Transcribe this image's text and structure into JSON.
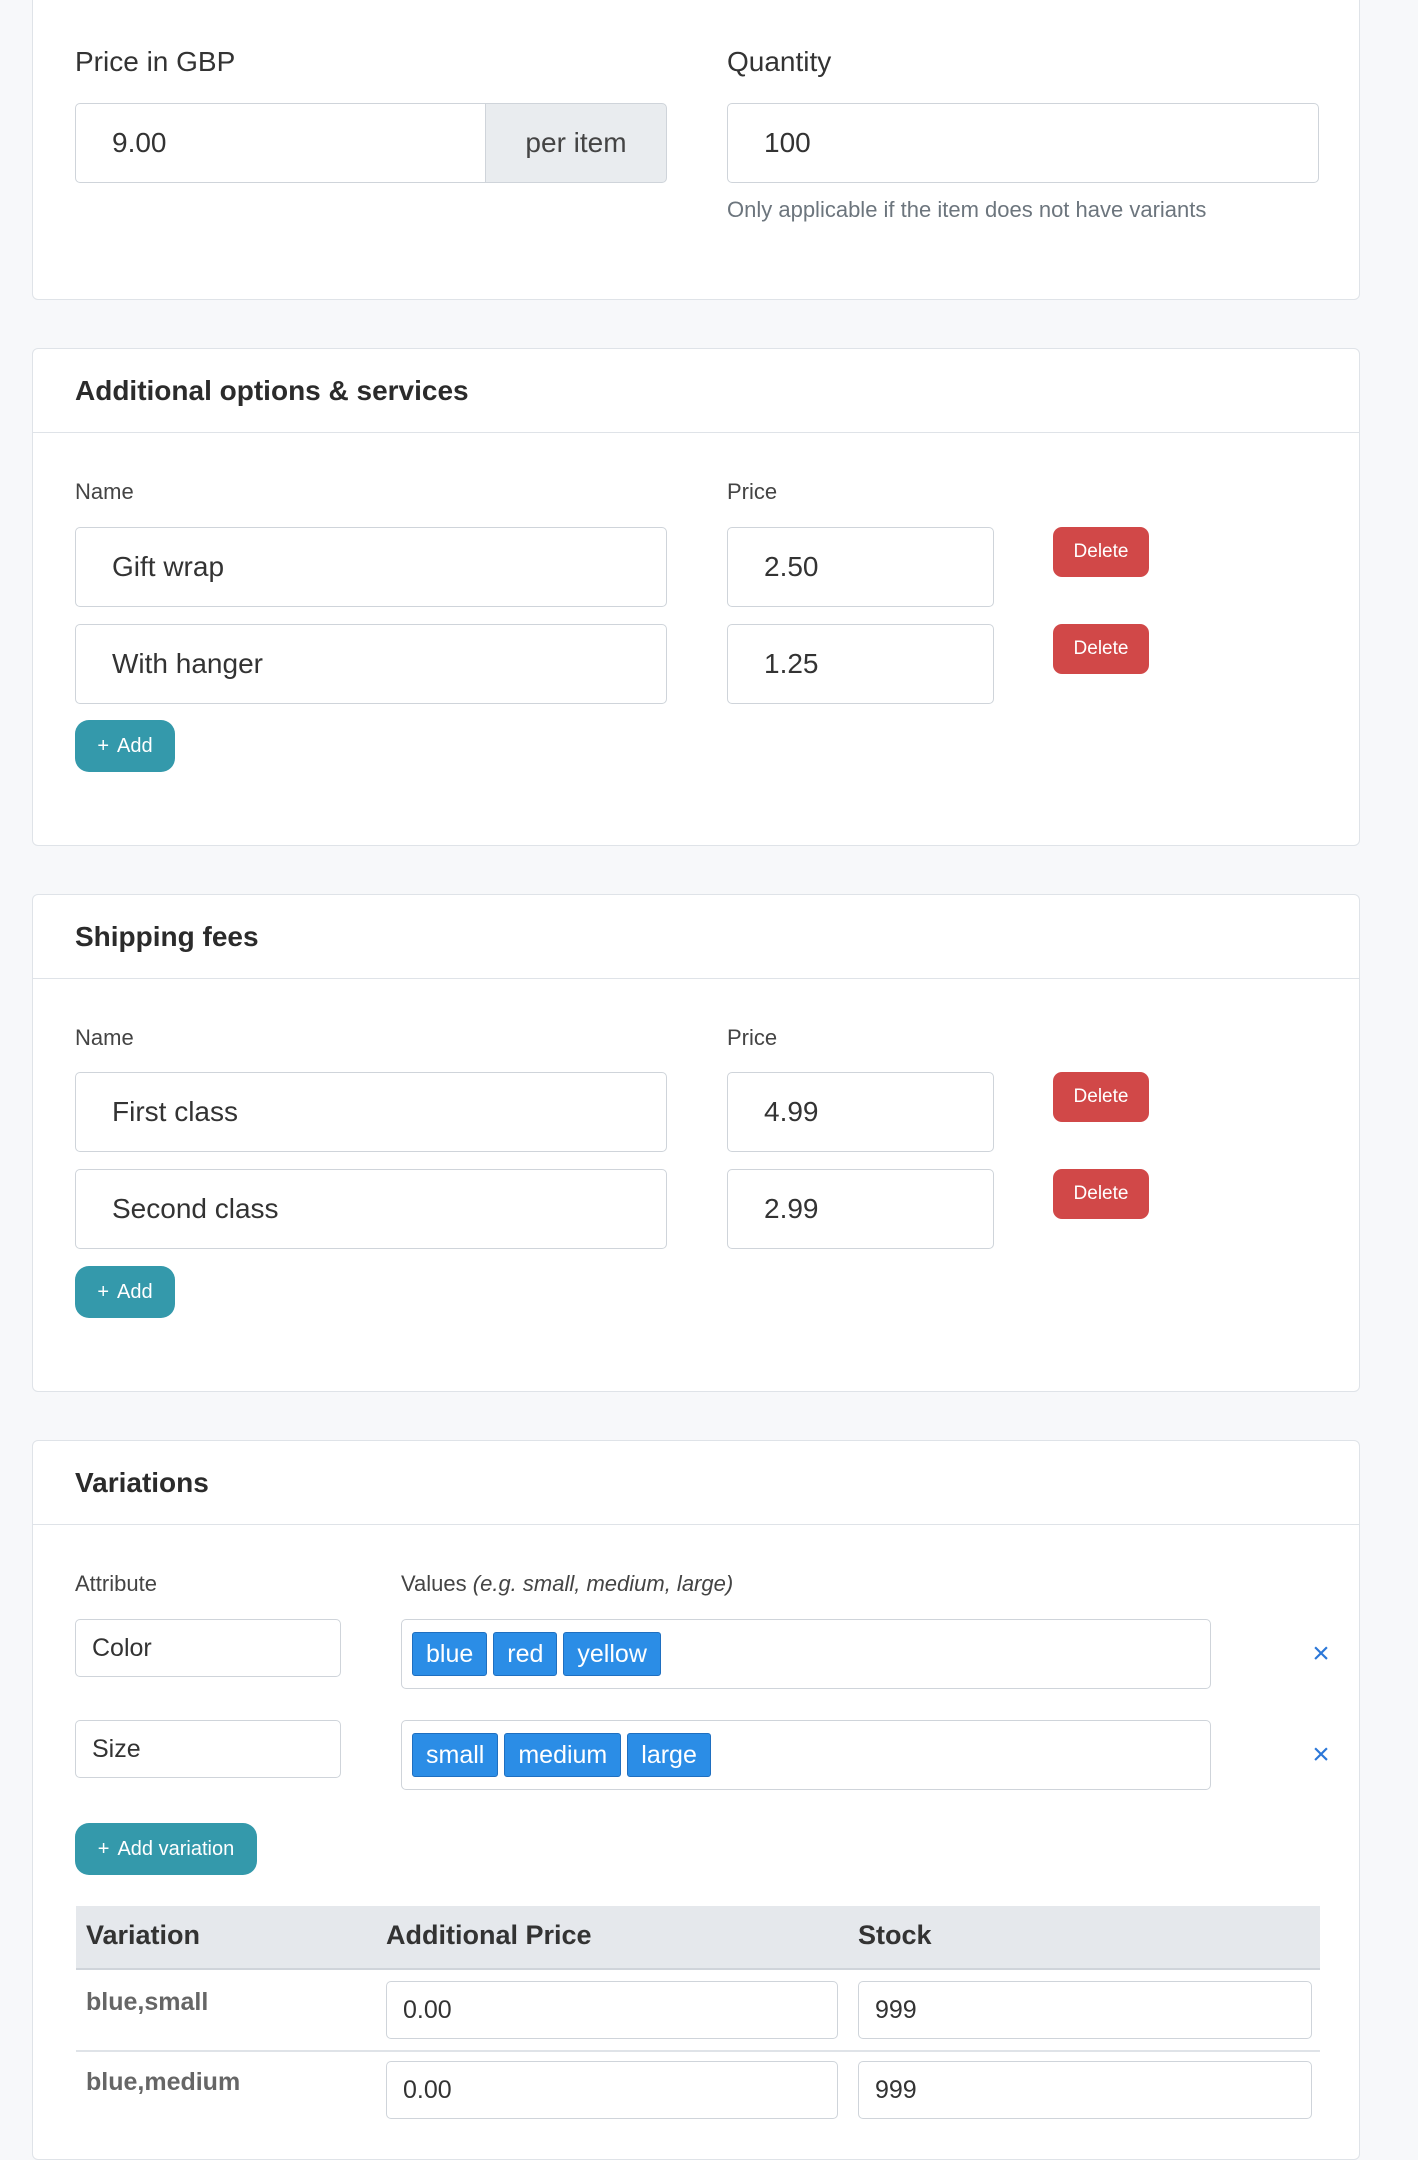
{
  "pricing": {
    "price_label": "Price in GBP",
    "price_value": "9.00",
    "price_addon": "per item",
    "quantity_label": "Quantity",
    "quantity_value": "100",
    "quantity_help": "Only applicable if the item does not have variants"
  },
  "options": {
    "title": "Additional options & services",
    "name_label": "Name",
    "price_label": "Price",
    "rows": [
      {
        "name": "Gift wrap",
        "price": "2.50",
        "delete_label": "Delete"
      },
      {
        "name": "With hanger",
        "price": "1.25",
        "delete_label": "Delete"
      }
    ],
    "add_label": "Add"
  },
  "shipping": {
    "title": "Shipping fees",
    "name_label": "Name",
    "price_label": "Price",
    "rows": [
      {
        "name": "First class",
        "price": "4.99",
        "delete_label": "Delete"
      },
      {
        "name": "Second class",
        "price": "2.99",
        "delete_label": "Delete"
      }
    ],
    "add_label": "Add"
  },
  "variations": {
    "title": "Variations",
    "attribute_label": "Attribute",
    "values_label": "Values",
    "values_hint": "(e.g. small, medium, large)",
    "attributes": [
      {
        "name": "Color",
        "values": [
          "blue",
          "red",
          "yellow"
        ],
        "remove_icon": "×"
      },
      {
        "name": "Size",
        "values": [
          "small",
          "medium",
          "large"
        ],
        "remove_icon": "×"
      }
    ],
    "add_variation_label": "Add variation",
    "table": {
      "headers": [
        "Variation",
        "Additional Price",
        "Stock"
      ],
      "rows": [
        {
          "variation": "blue,small",
          "additional_price": "0.00",
          "stock": "999"
        },
        {
          "variation": "blue,medium",
          "additional_price": "0.00",
          "stock": "999"
        }
      ]
    }
  },
  "icons": {
    "plus": "+",
    "close": "×"
  },
  "colors": {
    "danger": "#d14848",
    "primary": "#3499ab",
    "tag": "#2b8de6",
    "link": "#2b77d8"
  }
}
